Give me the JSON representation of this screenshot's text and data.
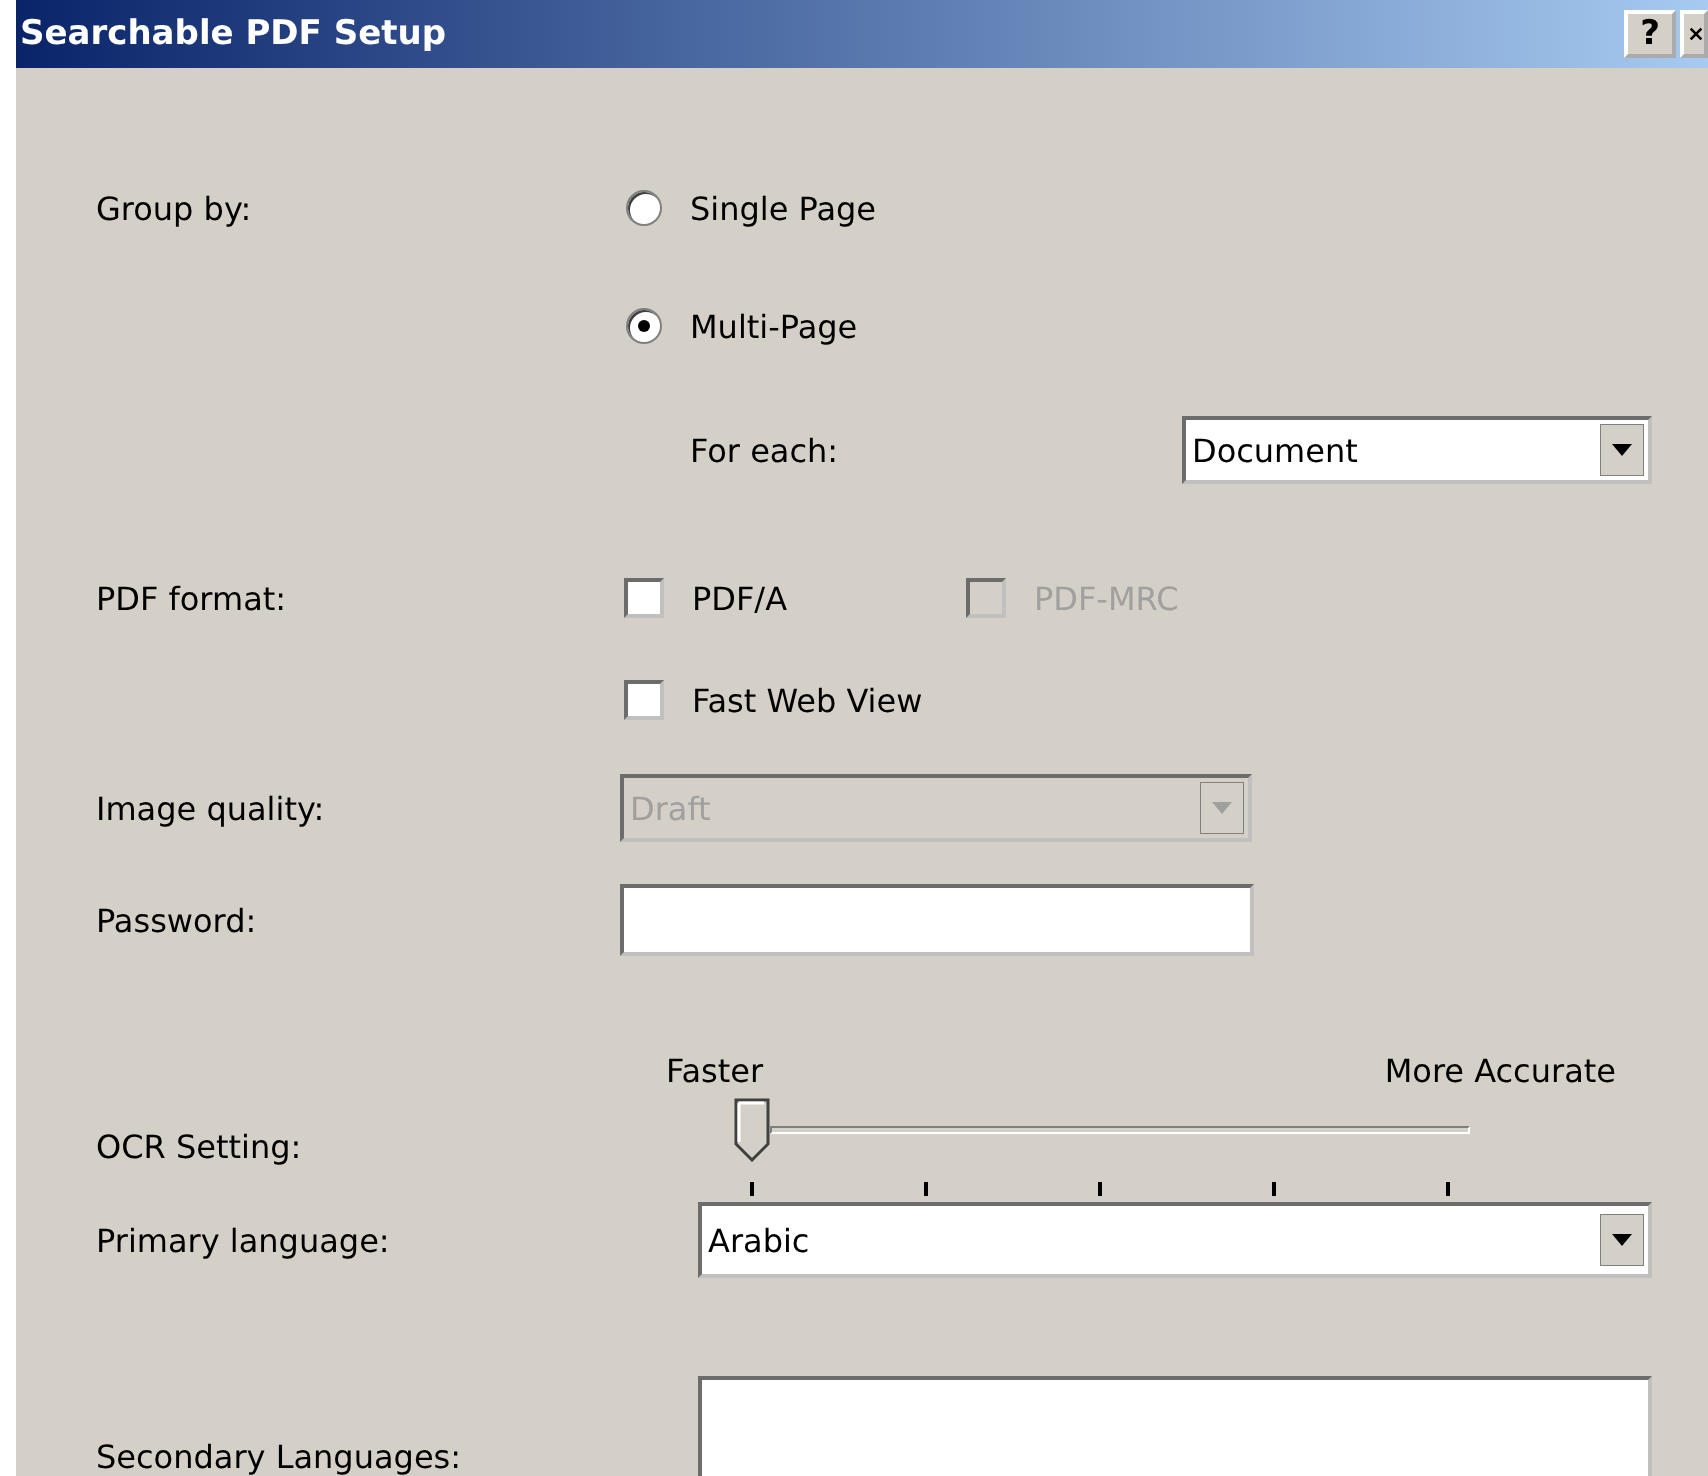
{
  "window": {
    "title": "Searchable PDF Setup",
    "help_button": "?"
  },
  "group_by": {
    "label": "Group by:",
    "options": [
      {
        "label": "Single Page",
        "selected": false
      },
      {
        "label": "Multi-Page",
        "selected": true
      }
    ]
  },
  "for_each": {
    "label": "For each:",
    "value": "Document"
  },
  "pdf_format": {
    "label": "PDF format:",
    "options": [
      {
        "label": "PDF/A",
        "checked": false,
        "disabled": false
      },
      {
        "label": "PDF-MRC",
        "checked": false,
        "disabled": true
      },
      {
        "label": "Fast Web View",
        "checked": false,
        "disabled": false
      }
    ]
  },
  "image_quality": {
    "label": "Image quality:",
    "value": "Draft",
    "disabled": true
  },
  "password": {
    "label": "Password:"
  },
  "ocr_setting": {
    "label": "OCR Setting:",
    "min_label": "Faster",
    "max_label": "More Accurate",
    "level": 0
  },
  "primary_language": {
    "label": "Primary language:",
    "value": "Arabic"
  },
  "secondary_languages": {
    "label": "Secondary Languages:"
  }
}
